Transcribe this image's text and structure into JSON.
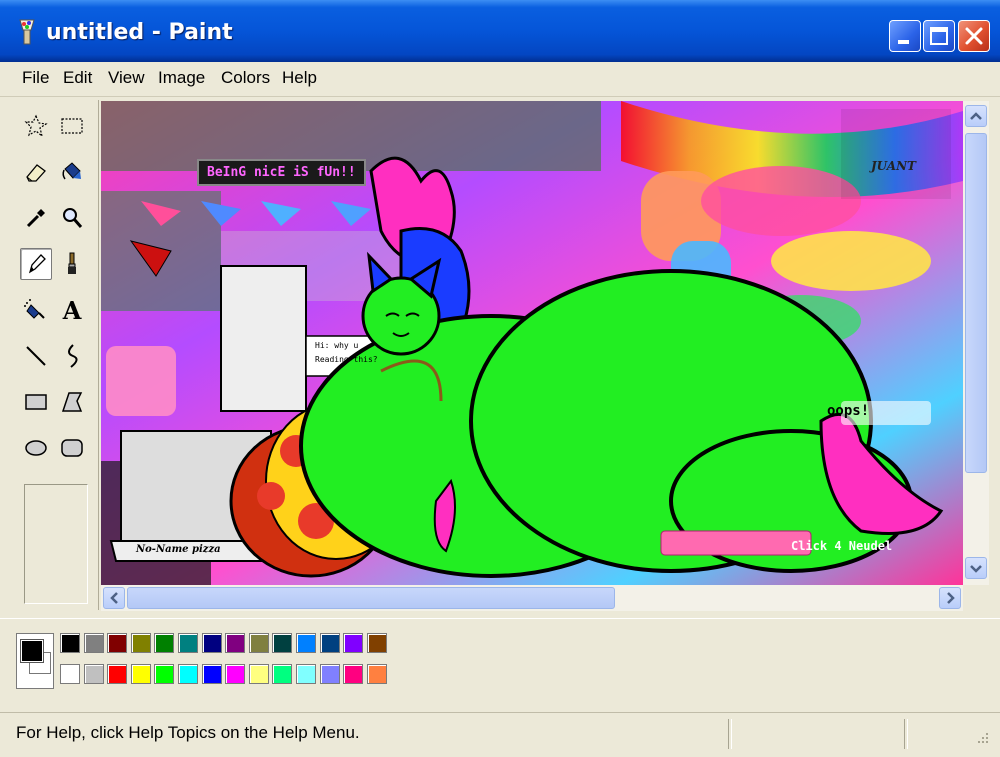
{
  "window": {
    "title": "untitled - Paint"
  },
  "menu": [
    "File",
    "Edit",
    "View",
    "Image",
    "Colors",
    "Help"
  ],
  "tools": [
    {
      "icon": "free-form-select-icon"
    },
    {
      "icon": "rect-select-icon"
    },
    {
      "icon": "eraser-icon"
    },
    {
      "icon": "fill-bucket-icon"
    },
    {
      "icon": "color-picker-icon"
    },
    {
      "icon": "magnifier-icon"
    },
    {
      "icon": "pencil-icon",
      "selected": true
    },
    {
      "icon": "brush-icon"
    },
    {
      "icon": "airbrush-icon"
    },
    {
      "icon": "text-tool-icon",
      "glyph": "A"
    },
    {
      "icon": "line-icon"
    },
    {
      "icon": "curve-icon"
    },
    {
      "icon": "rectangle-icon"
    },
    {
      "icon": "polygon-icon"
    },
    {
      "icon": "ellipse-icon"
    },
    {
      "icon": "rounded-rect-icon"
    }
  ],
  "canvas": {
    "image": {
      "signs": {
        "nice_sign": "BeInG nicE iS fUn!!",
        "note_line1": "Hi: why u",
        "note_line2": "Reading this?",
        "pizza_box": "No-Name pizza",
        "oops": "oops!",
        "click_button": "Click 4 Neudel",
        "artist_signature": "JUANT"
      }
    }
  },
  "palette": {
    "foreground": "#000000",
    "background": "#ffffff",
    "row1": [
      "#000000",
      "#808080",
      "#800000",
      "#808000",
      "#008000",
      "#008080",
      "#000080",
      "#800080",
      "#808040",
      "#004040",
      "#0080ff",
      "#004080",
      "#8000ff",
      "#804000"
    ],
    "row2": [
      "#ffffff",
      "#c0c0c0",
      "#ff0000",
      "#ffff00",
      "#00ff00",
      "#00ffff",
      "#0000ff",
      "#ff00ff",
      "#ffff80",
      "#00ff80",
      "#80ffff",
      "#8080ff",
      "#ff0080",
      "#ff8040"
    ]
  },
  "status": {
    "help_text": "For Help, click Help Topics on the Help Menu."
  },
  "theme": {
    "accent": "#0555d8",
    "chrome": "#ece9d8",
    "character": "#22ee22"
  }
}
